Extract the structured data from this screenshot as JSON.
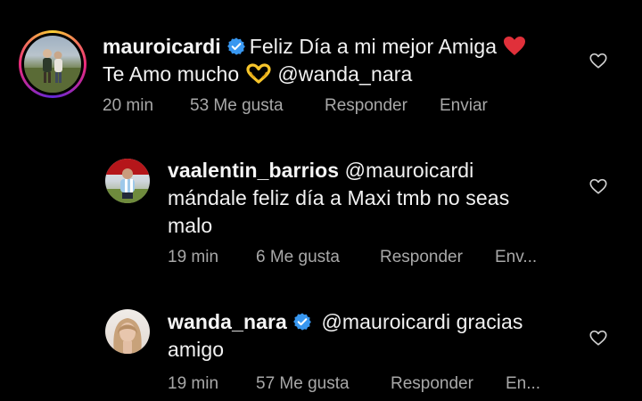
{
  "comments": [
    {
      "username": "mauroicardi",
      "verified": true,
      "text_part1": "Feliz Día a mi mejor Amiga",
      "emoji1": "red-heart",
      "text_part2": "Te Amo mucho",
      "emoji2": "heart-hands",
      "mention": "@wanda_nara",
      "time": "20 min",
      "likes": "53 Me gusta",
      "reply": "Responder",
      "send": "Enviar"
    },
    {
      "username": "vaalentin_barrios",
      "verified": false,
      "mention": "@mauroicardi",
      "text_line2": "mándale feliz día a Maxi tmb no seas",
      "text_line3": "malo",
      "time": "19 min",
      "likes": "6 Me gusta",
      "reply": "Responder",
      "send": "Env..."
    },
    {
      "username": "wanda_nara",
      "verified": true,
      "mention": "@mauroicardi",
      "text_part1": "gracias",
      "text_line2": "amigo",
      "time": "19 min",
      "likes": "57 Me gusta",
      "reply": "Responder",
      "send": "En..."
    }
  ],
  "colors": {
    "background": "#000000",
    "text": "#f5f5f5",
    "meta": "#a8a8a8",
    "verified": "#3897f0",
    "heart": "#e0303a"
  }
}
